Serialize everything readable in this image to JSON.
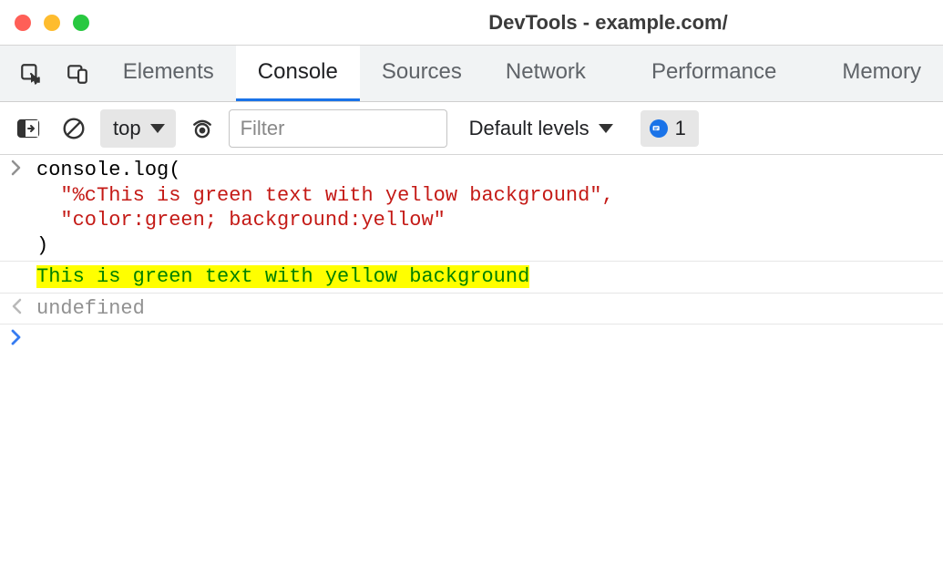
{
  "titlebar": {
    "title": "DevTools - example.com/"
  },
  "tabs": [
    {
      "label": "Elements",
      "active": false
    },
    {
      "label": "Console",
      "active": true
    },
    {
      "label": "Sources",
      "active": false
    },
    {
      "label": "Network",
      "active": false
    },
    {
      "label": "Performance",
      "active": false
    },
    {
      "label": "Memory",
      "active": false
    }
  ],
  "toolbar": {
    "context_label": "top",
    "filter_placeholder": "Filter",
    "levels_label": "Default levels",
    "issues_count": "1"
  },
  "console": {
    "input_line1": "console.log(",
    "input_line2": "  \"%cThis is green text with yellow background\",",
    "input_line3": "  \"color:green; background:yellow\"",
    "input_line4": ")",
    "output_text": "This is green text with yellow background",
    "return_value": "undefined",
    "styled_color": "#008000",
    "styled_background": "#ffff00"
  }
}
